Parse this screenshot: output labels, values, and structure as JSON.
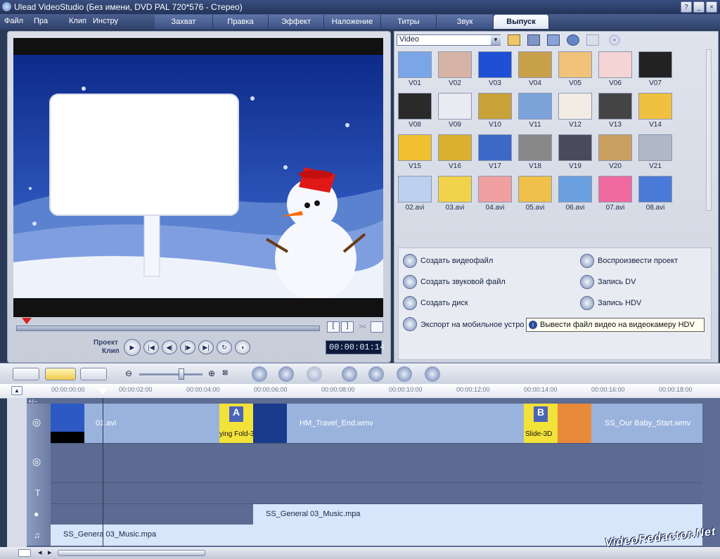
{
  "window": {
    "title": "Ulead VideoStudio (Без имени, DVD PAL 720*576 - Стерео)"
  },
  "menu": [
    "Файл",
    "Пра",
    "Клип",
    "Инстру"
  ],
  "tabs": [
    "Захват",
    "Правка",
    "Эффект",
    "Наложение",
    "Титры",
    "Звук",
    "Выпуск"
  ],
  "active_tab": "Выпуск",
  "library": {
    "dropdown": "Video",
    "items": [
      "V01",
      "V02",
      "V03",
      "V04",
      "V05",
      "V06",
      "V07",
      "V08",
      "V09",
      "V10",
      "V11",
      "V12",
      "V13",
      "V14",
      "V15",
      "V16",
      "V17",
      "V18",
      "V19",
      "V20",
      "V21",
      "02.avi",
      "03.avi",
      "04.avi",
      "05.avi",
      "06.avi",
      "07.avi",
      "08.avi"
    ]
  },
  "output": {
    "create_video": "Создать видеофайл",
    "create_audio": "Создать звуковой файл",
    "create_disc": "Создать диск",
    "export_mobile": "Экспорт на мобильное устро",
    "play_project": "Воспроизвести проект",
    "record_dv": "Запись DV",
    "record_hdv": "Запись HDV",
    "tooltip": "Вывести файл видео на видеокамеру HDV"
  },
  "player": {
    "project_label": "Проект",
    "clip_label": "Клип",
    "timecode": "00:00:01:14"
  },
  "ruler": [
    "00:00:00:00",
    "00:00:02:00",
    "00:00:04:00",
    "00:00:06:00",
    "00:00:08:00",
    "00:00:10:00",
    "00:00:12:00",
    "00:00:14:00",
    "00:00:16:00",
    "00:00:18:00"
  ],
  "timeline": {
    "clips": [
      "01.avi",
      "ying Fold-3",
      "HM_Travel_End.wmv",
      "Slide-3D",
      "SS_Our Baby_Start.wmv"
    ],
    "music1": "SS_General 03_Music.mpa",
    "music2": "SS_Genera 03_Music.mpa"
  },
  "watermark": "VideoRedactor.Net"
}
